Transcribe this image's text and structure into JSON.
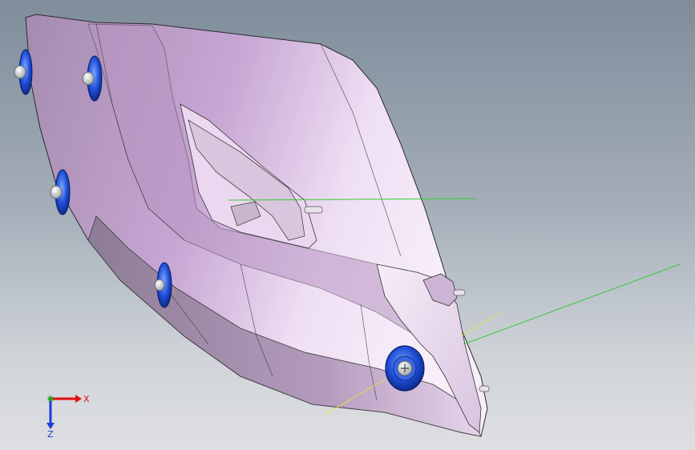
{
  "viewport": {
    "background_top": "#7f8d9b",
    "background_bottom": "#dedfe2"
  },
  "model": {
    "part_color": "#c9a6d4",
    "highlight_color": "#f3e7f6",
    "fastener_color": "#1f4ed8",
    "reference_line_colors": [
      "#33cc33",
      "#e8e04a"
    ]
  },
  "triad": {
    "x_label": "X",
    "z_label": "Z",
    "x_color": "#e01010",
    "y_color": "#18b018",
    "z_color": "#1a3bd6"
  }
}
